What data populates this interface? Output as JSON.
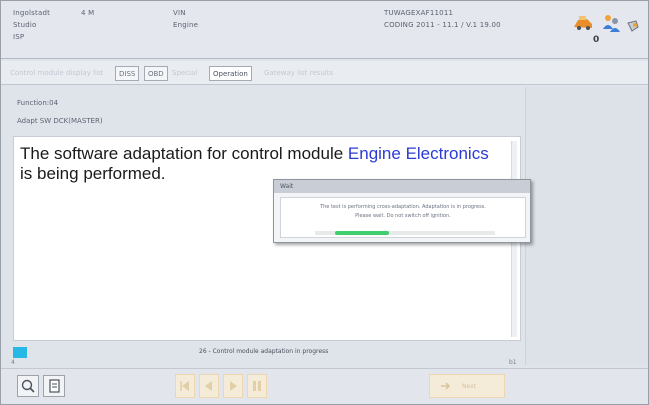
{
  "header": {
    "col1": [
      "Ingolstadt",
      "Studio",
      "ISP"
    ],
    "col1_value": "4 M",
    "col2": [
      "VIN",
      "Engine"
    ],
    "col3": [
      "TUWAGEXAF11011",
      "CODING 2011 - 11.1 / V.1 19.00"
    ],
    "user_count": "0"
  },
  "tabs": [
    "Control module display list",
    "DISS",
    "OBD",
    "Special",
    "Operation",
    "Gateway list results"
  ],
  "breadcrumbs": [
    "Function:04",
    "Adapt SW DCK(MASTER)"
  ],
  "message": {
    "before": "The software adaptation for control module ",
    "module": "Engine Electronics",
    "after": " is being performed."
  },
  "dialog": {
    "title": "Wait",
    "line1": "The test is performing cross-adaptation. Adaptation is in progress.",
    "line2": "Please wait. Do not switch off ignition.",
    "progress": 0.3
  },
  "status": {
    "text": "26 - Control module adaptation in progress",
    "tick_left": "4",
    "tick_right": "b1"
  },
  "footer": {
    "next_label": "Next"
  }
}
